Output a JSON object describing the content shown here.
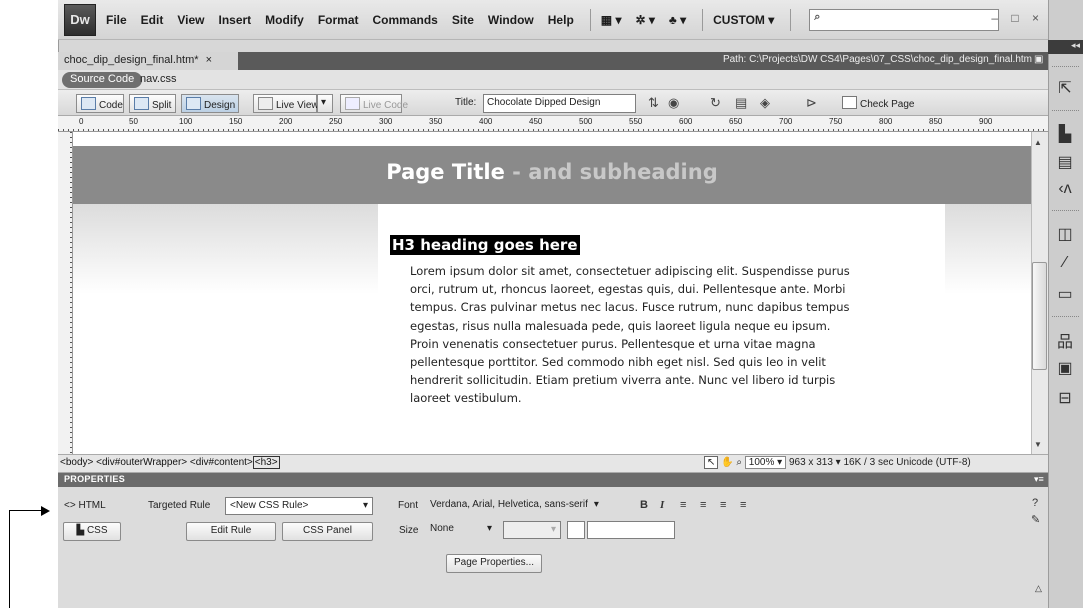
{
  "app": {
    "logo": "Dw",
    "menu": [
      "File",
      "Edit",
      "View",
      "Insert",
      "Modify",
      "Format",
      "Commands",
      "Site",
      "Window",
      "Help"
    ],
    "workspace": "CUSTOM"
  },
  "document": {
    "tab": "choc_dip_design_final.htm*",
    "tab_close": "×",
    "path": "Path:  C:\\Projects\\DW CS4\\Pages\\07_CSS\\choc_dip_design_final.htm",
    "related_files": [
      "Source Code",
      "nav.css"
    ]
  },
  "toolbar": {
    "code": "Code",
    "split": "Split",
    "design": "Design",
    "live_view": "Live View",
    "live_code": "Live Code",
    "title_label": "Title:",
    "title_value": "Chocolate Dipped Design",
    "check_page": "Check Page"
  },
  "ruler": {
    "h_ticks": [
      "0",
      "50",
      "100",
      "150",
      "200",
      "250",
      "300",
      "350",
      "400",
      "450",
      "500",
      "550",
      "600",
      "650",
      "700",
      "750",
      "800",
      "850",
      "900"
    ]
  },
  "page": {
    "title": "Page Title",
    "subheading": " - and subheading",
    "h3": "H3 heading goes here",
    "body_lines": [
      "Lorem ipsum dolor sit amet, consectetuer adipiscing elit. Suspendisse purus",
      "orci, rutrum ut, rhoncus laoreet, egestas quis, dui. Pellentesque ante. Morbi",
      "tempus. Cras pulvinar metus nec lacus. Fusce rutrum, nunc dapibus tempus",
      "egestas, risus nulla malesuada pede, quis laoreet ligula neque eu ipsum.",
      "Proin venenatis consectetuer purus. Pellentesque et urna vitae magna",
      "pellentesque porttitor. Sed commodo nibh eget nisl. Sed quis leo in velit",
      "hendrerit sollicitudin. Etiam pretium viverra ante. Nunc vel libero id turpis",
      "laoreet vestibulum."
    ]
  },
  "status": {
    "tags": [
      "<body>",
      "<div#outerWrapper>",
      "<div#content>"
    ],
    "active_tag": "<h3>",
    "zoom": "100%",
    "size": "963 x 313",
    "download": "16K / 3 sec",
    "encoding": "Unicode (UTF-8)"
  },
  "properties": {
    "header": "PROPERTIES",
    "html_tab": "HTML",
    "css_tab": "CSS",
    "targeted_rule_label": "Targeted Rule",
    "targeted_rule_value": "<New CSS Rule>",
    "edit_rule": "Edit Rule",
    "css_panel": "CSS Panel",
    "font_label": "Font",
    "font_value": "Verdana, Arial, Helvetica, sans-serif",
    "size_label": "Size",
    "size_value": "None",
    "page_properties": "Page Properties..."
  }
}
